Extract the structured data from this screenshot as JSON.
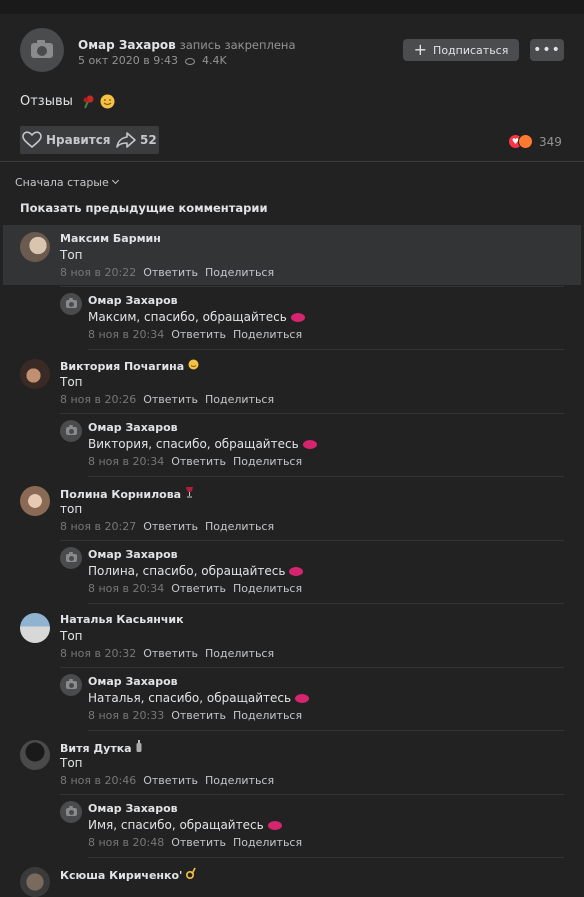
{
  "colors": {
    "bg": "#222222",
    "text": "#e1e3e6",
    "muted": "#939393",
    "button": "#4b4c4e",
    "heart": "#ff3347"
  },
  "post": {
    "author": "Омар Захаров",
    "note": "запись закреплена",
    "date": "5 окт 2020 в 9:43",
    "views": "4.4K",
    "subscribe_label": "Подписаться",
    "more_label": "•••",
    "text": "Отзывы",
    "like_label": "Нравится",
    "share_count": "52",
    "reactions_count": "349"
  },
  "comments_header": {
    "sort_label": "Сначала старые",
    "show_prev": "Показать предыдущие комментарии"
  },
  "comments": [
    {
      "name": "Максим Бармин",
      "text": "Топ",
      "date": "8 ноя в 20:22",
      "reply": "Ответить",
      "share": "Поделиться",
      "answer": {
        "name": "Омар Захаров",
        "text": "Максим, спасибо, обращайтесь",
        "date": "8 ноя в 20:34",
        "reply": "Ответить",
        "share": "Поделиться"
      }
    },
    {
      "name": "Виктория Почагина",
      "text": "Топ",
      "date": "8 ноя в 20:26",
      "reply": "Ответить",
      "share": "Поделиться",
      "answer": {
        "name": "Омар Захаров",
        "text": "Виктория, спасибо, обращайтесь",
        "date": "8 ноя в 20:34",
        "reply": "Ответить",
        "share": "Поделиться"
      }
    },
    {
      "name": "Полина Корнилова",
      "text": "топ",
      "date": "8 ноя в 20:27",
      "reply": "Ответить",
      "share": "Поделиться",
      "answer": {
        "name": "Омар Захаров",
        "text": "Полина, спасибо, обращайтесь",
        "date": "8 ноя в 20:34",
        "reply": "Ответить",
        "share": "Поделиться"
      }
    },
    {
      "name": "Наталья Касьянчик",
      "text": "Топ",
      "date": "8 ноя в 20:32",
      "reply": "Ответить",
      "share": "Поделиться",
      "answer": {
        "name": "Омар Захаров",
        "text": "Наталья, спасибо, обращайтесь",
        "date": "8 ноя в 20:33",
        "reply": "Ответить",
        "share": "Поделиться"
      }
    },
    {
      "name": "Витя Дутка",
      "text": "Топ",
      "date": "8 ноя в 20:46",
      "reply": "Ответить",
      "share": "Поделиться",
      "answer": {
        "name": "Омар Захаров",
        "text": "Имя, спасибо, обращайтесь",
        "date": "8 ноя в 20:48",
        "reply": "Ответить",
        "share": "Поделиться"
      }
    },
    {
      "name": "Ксюша Кириченко'"
    }
  ]
}
